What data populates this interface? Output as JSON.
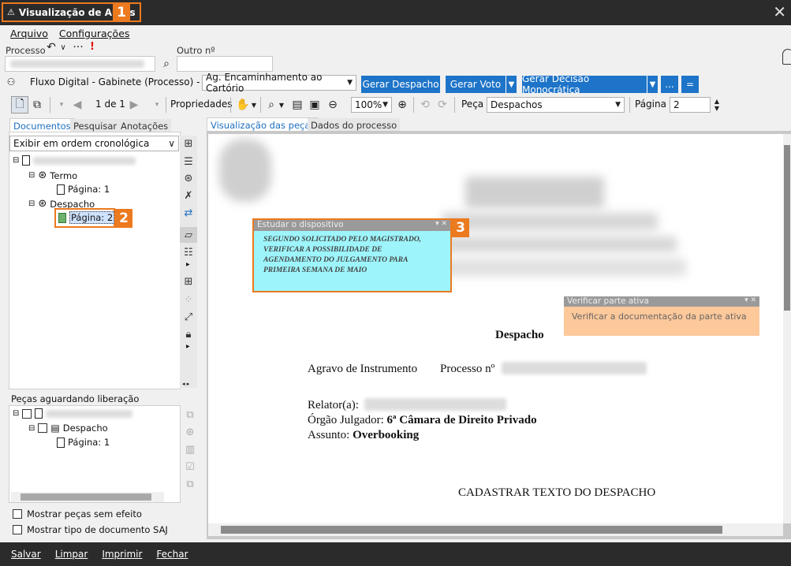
{
  "window": {
    "title": "Visualização de Autos",
    "title_badge": "1",
    "close": "✕"
  },
  "menu": {
    "items": [
      "Arquivo",
      "Configurações"
    ]
  },
  "process": {
    "label_processo": "Processo",
    "label_outro": "Outro nº",
    "warn": "!"
  },
  "flow": {
    "text": "Fluxo Digital - Gabinete (Processo) - Fila:",
    "queue": "Ag. Encaminhamento ao Cartório",
    "buttons": {
      "despacho": "Gerar Despacho",
      "voto": "Gerar Voto",
      "decisao": "Gerar Decisão Monocrática",
      "more": "...",
      "collapse": "="
    }
  },
  "toolbar": {
    "page_nav": "1 de 1",
    "propriedades": "Propriedades",
    "zoom": "100%",
    "peca_label": "Peça",
    "peca_value": "Despachos",
    "pagina_label": "Página",
    "pagina_value": "2"
  },
  "left_tabs": [
    "Documentos",
    "Pesquisar",
    "Anotações"
  ],
  "order_select": "Exibir em ordem cronológica",
  "tree": {
    "termo": "Termo",
    "termo_page": "Página: 1",
    "despacho": "Despacho",
    "despacho_page": "Página: 2",
    "badge2": "2"
  },
  "pending": {
    "title": "Peças aguardando liberação",
    "despacho": "Despacho",
    "page": "Página: 1"
  },
  "checkboxes": {
    "sem_efeito": "Mostrar peças sem efeito",
    "tipo_saj": "Mostrar tipo de documento SAJ"
  },
  "right_tabs": [
    "Visualização das peças",
    "Dados do processo"
  ],
  "note1": {
    "title": "Estudar o dispositivo",
    "body": "SEGUNDO SOLICITADO PELO MAGISTRADO, VERIFICAR A POSSIBILIDADE DE AGENDAMENTO DO JULGAMENTO PARA PRIMEIRA SEMANA DE MAIO",
    "badge": "3"
  },
  "note2": {
    "title": "Verificar parte ativa",
    "body": "Verificar a documentação da parte ativa"
  },
  "document": {
    "heading": "Despacho",
    "agravo": "Agravo de Instrumento",
    "processo": "Processo nº",
    "relator": "Relator(a):",
    "orgao_label": "Órgão Julgador:",
    "orgao_value": "6ª Câmara de Direito Privado",
    "assunto_label": "Assunto:",
    "assunto_value": "Overbooking",
    "placeholder": "CADASTRAR TEXTO DO DESPACHO"
  },
  "status": {
    "items": [
      "Salvar",
      "Limpar",
      "Imprimir",
      "Fechar"
    ]
  },
  "colors": {
    "accent_orange": "#ec7a1f",
    "blue_button": "#1e74c8",
    "note_cyan": "#9df5fb",
    "note_peach": "#fdc89a",
    "dark_bar": "#2b2b2b"
  }
}
